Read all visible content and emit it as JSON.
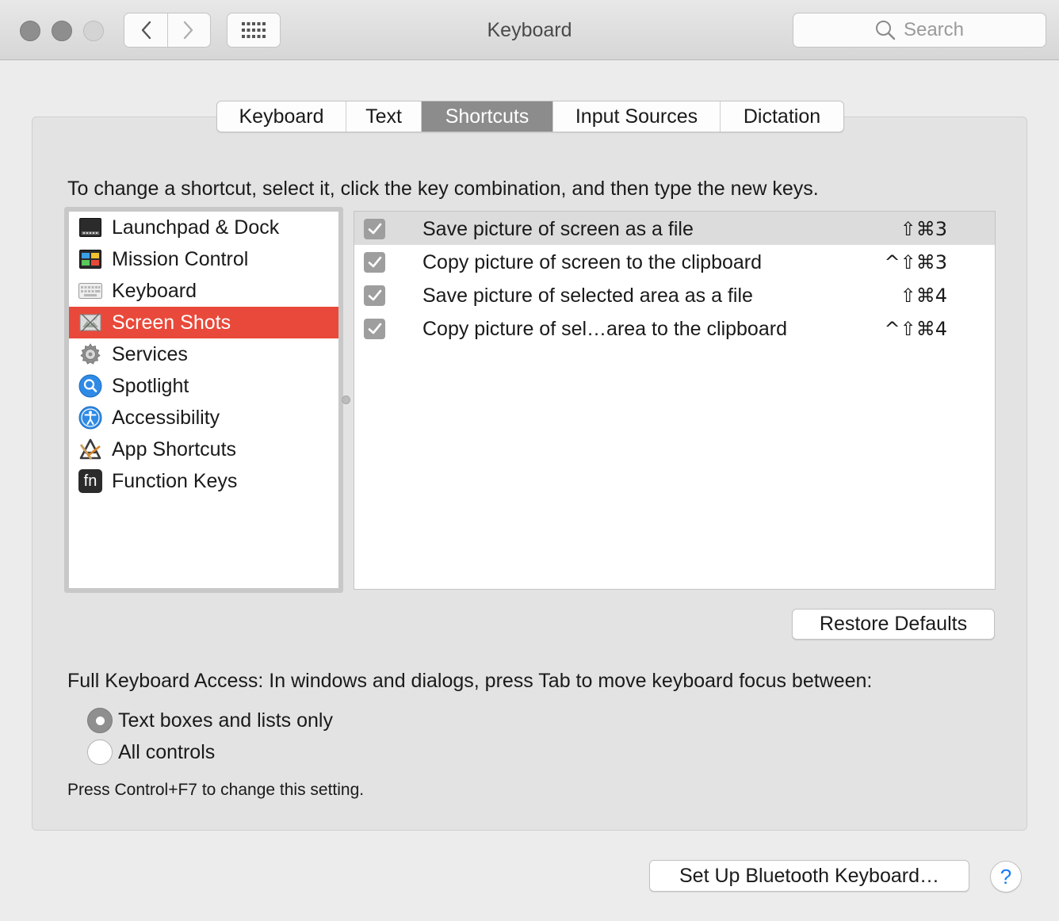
{
  "window": {
    "title": "Keyboard"
  },
  "search": {
    "placeholder": "Search"
  },
  "tabs": [
    {
      "label": "Keyboard",
      "active": false
    },
    {
      "label": "Text",
      "active": false
    },
    {
      "label": "Shortcuts",
      "active": true
    },
    {
      "label": "Input Sources",
      "active": false
    },
    {
      "label": "Dictation",
      "active": false
    }
  ],
  "instructions": "To change a shortcut, select it, click the key combination, and then type the new keys.",
  "categories": [
    {
      "label": "Launchpad & Dock",
      "icon": "launchpad-dock-icon"
    },
    {
      "label": "Mission Control",
      "icon": "mission-control-icon"
    },
    {
      "label": "Keyboard",
      "icon": "keyboard-icon"
    },
    {
      "label": "Screen Shots",
      "icon": "screenshot-icon",
      "selected": true
    },
    {
      "label": "Services",
      "icon": "gear-icon"
    },
    {
      "label": "Spotlight",
      "icon": "spotlight-icon"
    },
    {
      "label": "Accessibility",
      "icon": "accessibility-icon"
    },
    {
      "label": "App Shortcuts",
      "icon": "app-shortcuts-icon"
    },
    {
      "label": "Function Keys",
      "icon": "function-keys-icon"
    }
  ],
  "fn_icon_text": "fn",
  "shortcuts": [
    {
      "label": "Save picture of screen as a file",
      "keys": "⇧⌘3",
      "checked": true,
      "selected": true
    },
    {
      "label": "Copy picture of screen to the clipboard",
      "keys": "^⇧⌘3",
      "checked": true
    },
    {
      "label": "Save picture of selected area as a file",
      "keys": "⇧⌘4",
      "checked": true
    },
    {
      "label": "Copy picture of sel…area to the clipboard",
      "keys": "^⇧⌘4",
      "checked": true
    }
  ],
  "restore_defaults_label": "Restore Defaults",
  "full_keyboard_access": {
    "label": "Full Keyboard Access: In windows and dialogs, press Tab to move keyboard focus between:",
    "options": [
      {
        "label": "Text boxes and lists only",
        "checked": true
      },
      {
        "label": "All controls",
        "checked": false
      }
    ],
    "hint": "Press Control+F7 to change this setting."
  },
  "bluetooth_button_label": "Set Up Bluetooth Keyboard…",
  "help_label": "?",
  "colors": {
    "selection_red": "#e9493a",
    "active_tab_gray": "#8c8c8c",
    "help_blue": "#1a7cf2"
  }
}
